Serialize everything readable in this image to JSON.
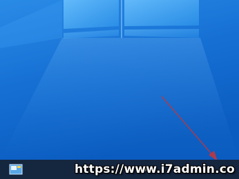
{
  "watermark": {
    "text": "https://www.i7admin.co"
  },
  "taskbar": {
    "app_icon": "app-window-icon"
  },
  "colors": {
    "taskbar": "#15263f",
    "desktop_top": "#1c7ad9",
    "desktop_bottom": "#0a58b8",
    "arrow": "#b03a4a"
  }
}
